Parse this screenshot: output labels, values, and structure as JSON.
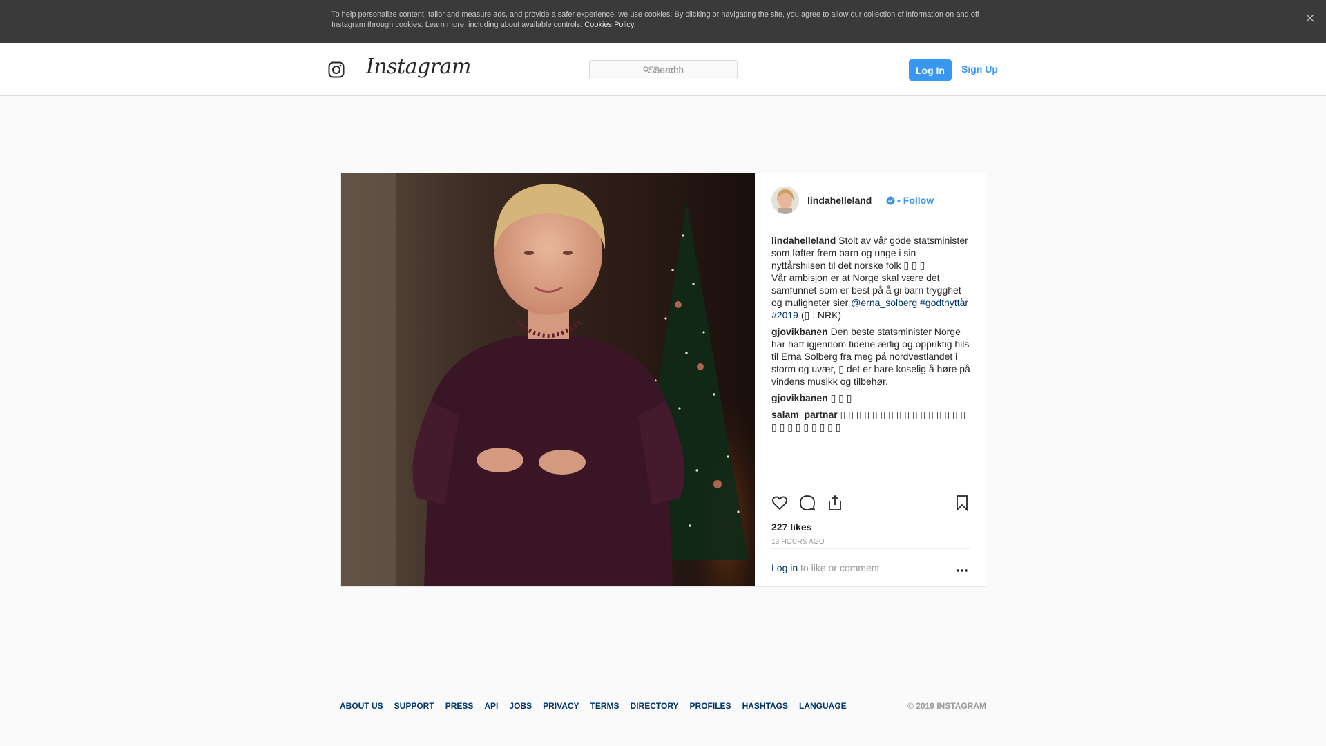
{
  "cookie_banner": {
    "text": "To help personalize content, tailor and measure ads, and provide a safer experience, we use cookies. By clicking or navigating the site, you agree to allow our collection of information on and off Instagram through cookies. Learn more, including about available controls: ",
    "policy_link": "Cookies Policy",
    "period": "."
  },
  "header": {
    "logo_text": "Instagram",
    "search_placeholder": "Search",
    "login_label": "Log In",
    "signup_label": "Sign Up"
  },
  "post": {
    "username": "lindahelleland",
    "dot": "•",
    "follow_label": "Follow",
    "comments": [
      {
        "user": "lindahelleland",
        "text_1": " Stolt av vår gode statsminister som løfter frem barn og unge i sin nyttårshilsen til det norske folk ▯ ▯ ▯",
        "text_2": "Vår ambisjon er at Norge skal være det samfunnet som er best på å gi barn trygghet og muligheter sier ",
        "mention": "@erna_solberg",
        "hashtag_1": "#godtnyttår",
        "hashtag_2": "#2019",
        "text_3": " (▯ : NRK)"
      },
      {
        "user": "gjovikbanen",
        "text": " Den beste statsminister Norge har hatt igjennom tidene ærlig og oppriktig hils til Erna Solberg fra meg på nordvestlandet i storm og uvær, ▯  det er bare koselig å høre på vindens musikk og tilbehør."
      },
      {
        "user": "gjovikbanen",
        "text": " ▯ ▯ ▯"
      },
      {
        "user": "salam_partnar",
        "text": " ▯ ▯ ▯ ▯ ▯ ▯ ▯ ▯ ▯ ▯ ▯ ▯ ▯ ▯ ▯ ▯ ▯ ▯ ▯ ▯ ▯ ▯ ▯ ▯ ▯"
      }
    ],
    "likes": "227 likes",
    "time": "13 HOURS AGO",
    "login_prompt_link": "Log in",
    "login_prompt_text": " to like or comment."
  },
  "footer": {
    "links": [
      "About us",
      "Support",
      "Press",
      "API",
      "Jobs",
      "Privacy",
      "Terms",
      "Directory",
      "Profiles",
      "Hashtags",
      "Language"
    ],
    "copyright": "© 2019 INSTAGRAM"
  }
}
